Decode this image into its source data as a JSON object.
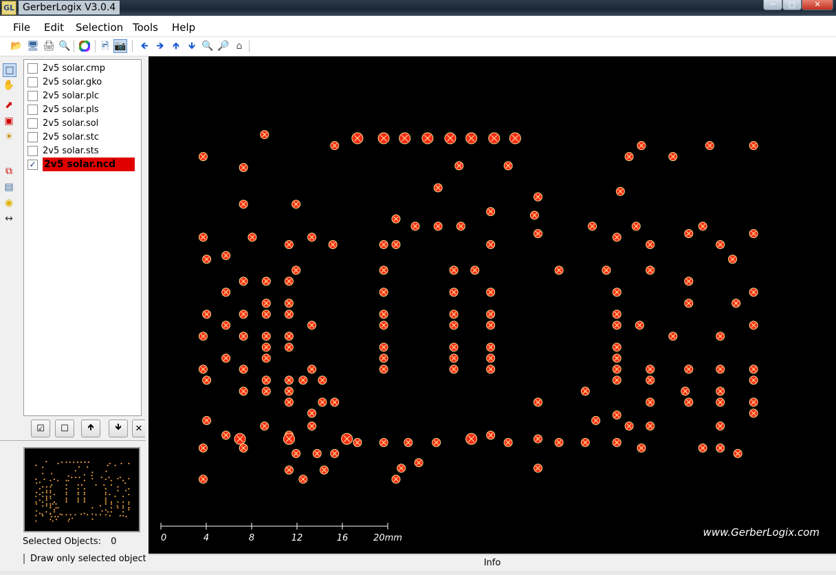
{
  "window": {
    "title": "GerberLogix   V3.0.4",
    "app_icon_text": "GL"
  },
  "menu": [
    "File",
    "Edit",
    "Selection",
    "Tools",
    "Help"
  ],
  "files": [
    {
      "name": "2v5 solar.cmp",
      "checked": false
    },
    {
      "name": "2v5 solar.gko",
      "checked": false
    },
    {
      "name": "2v5 solar.plc",
      "checked": false
    },
    {
      "name": "2v5 solar.pls",
      "checked": false
    },
    {
      "name": "2v5 solar.sol",
      "checked": false
    },
    {
      "name": "2v5 solar.stc",
      "checked": false
    },
    {
      "name": "2v5 solar.sts",
      "checked": false
    },
    {
      "name": "2v5 solar.ncd",
      "checked": true,
      "selected": true
    }
  ],
  "selected_objects_label": "Selected Objects:",
  "selected_objects_count": "0",
  "draw_only_label": "Draw only selected objects",
  "status_text": "Info",
  "watermark": "www.GerberLogix.com",
  "scale": {
    "ticks": [
      "0",
      "4",
      "8",
      "12",
      "16",
      "20mm"
    ]
  },
  "colors": {
    "hole_fill": "#f42a1a",
    "hole_ring": "#ffe088",
    "canvas_bg": "#000000",
    "selected_file_bg": "#e00000"
  },
  "board": {
    "holes_small": [
      [
        4.5,
        20.2
      ],
      [
        8.5,
        19.6
      ],
      [
        1.0,
        19.0
      ],
      [
        3.3,
        18.4
      ],
      [
        14.4,
        17.3
      ],
      [
        15.6,
        18.5
      ],
      [
        18.4,
        18.5
      ],
      [
        24.8,
        17.1
      ],
      [
        25.3,
        19.0
      ],
      [
        26.0,
        19.6
      ],
      [
        27.8,
        19.0
      ],
      [
        29.9,
        19.6
      ],
      [
        32.4,
        19.6
      ],
      [
        20.1,
        16.8
      ],
      [
        3.3,
        16.4
      ],
      [
        6.3,
        16.4
      ],
      [
        17.4,
        16.0
      ],
      [
        19.9,
        15.8
      ],
      [
        12.0,
        15.6
      ],
      [
        13.1,
        15.2
      ],
      [
        14.4,
        15.2
      ],
      [
        15.7,
        15.2
      ],
      [
        23.2,
        15.2
      ],
      [
        25.7,
        15.2
      ],
      [
        29.5,
        15.2
      ],
      [
        5.9,
        14.2
      ],
      [
        8.4,
        14.2
      ],
      [
        11.3,
        14.2
      ],
      [
        17.4,
        14.2
      ],
      [
        20.1,
        14.8
      ],
      [
        24.6,
        14.6
      ],
      [
        26.5,
        14.2
      ],
      [
        28.7,
        14.8
      ],
      [
        30.5,
        14.2
      ],
      [
        32.4,
        14.8
      ],
      [
        1.0,
        14.6
      ],
      [
        3.8,
        14.6
      ],
      [
        7.2,
        14.6
      ],
      [
        2.3,
        13.6
      ],
      [
        12.0,
        14.2
      ],
      [
        1.2,
        13.4
      ],
      [
        31.2,
        13.4
      ],
      [
        6.3,
        12.8
      ],
      [
        11.3,
        12.8
      ],
      [
        15.3,
        12.8
      ],
      [
        16.5,
        12.8
      ],
      [
        21.3,
        12.8
      ],
      [
        24.0,
        12.8
      ],
      [
        26.5,
        12.8
      ],
      [
        3.3,
        12.2
      ],
      [
        4.6,
        12.2
      ],
      [
        5.9,
        12.2
      ],
      [
        28.7,
        12.2
      ],
      [
        2.3,
        11.6
      ],
      [
        11.3,
        11.6
      ],
      [
        15.3,
        11.6
      ],
      [
        17.4,
        11.6
      ],
      [
        24.6,
        11.6
      ],
      [
        32.4,
        11.6
      ],
      [
        4.6,
        11.0
      ],
      [
        5.9,
        11.0
      ],
      [
        28.7,
        11.0
      ],
      [
        31.4,
        11.0
      ],
      [
        1.2,
        10.4
      ],
      [
        3.3,
        10.4
      ],
      [
        4.6,
        10.4
      ],
      [
        5.9,
        10.4
      ],
      [
        11.3,
        10.4
      ],
      [
        15.3,
        10.4
      ],
      [
        17.4,
        10.4
      ],
      [
        24.6,
        10.4
      ],
      [
        7.2,
        9.8
      ],
      [
        11.3,
        9.8
      ],
      [
        15.3,
        9.8
      ],
      [
        17.4,
        9.8
      ],
      [
        24.6,
        9.8
      ],
      [
        25.9,
        9.8
      ],
      [
        32.4,
        9.8
      ],
      [
        2.3,
        9.8
      ],
      [
        1.0,
        9.2
      ],
      [
        3.3,
        9.2
      ],
      [
        4.6,
        9.2
      ],
      [
        5.9,
        9.2
      ],
      [
        27.8,
        9.2
      ],
      [
        30.5,
        9.2
      ],
      [
        4.6,
        8.6
      ],
      [
        5.9,
        8.6
      ],
      [
        11.3,
        8.6
      ],
      [
        15.3,
        8.6
      ],
      [
        17.4,
        8.6
      ],
      [
        24.6,
        8.6
      ],
      [
        2.3,
        8.0
      ],
      [
        4.6,
        8.0
      ],
      [
        11.3,
        8.0
      ],
      [
        15.3,
        8.0
      ],
      [
        17.4,
        8.0
      ],
      [
        24.6,
        8.0
      ],
      [
        3.3,
        7.4
      ],
      [
        7.2,
        7.4
      ],
      [
        11.3,
        7.4
      ],
      [
        15.3,
        7.4
      ],
      [
        17.4,
        7.4
      ],
      [
        24.6,
        7.4
      ],
      [
        26.5,
        7.4
      ],
      [
        28.7,
        7.4
      ],
      [
        30.5,
        7.4
      ],
      [
        32.4,
        7.4
      ],
      [
        1.0,
        7.4
      ],
      [
        1.2,
        6.8
      ],
      [
        4.6,
        6.8
      ],
      [
        5.9,
        6.8
      ],
      [
        6.7,
        6.8
      ],
      [
        7.8,
        6.8
      ],
      [
        26.5,
        6.8
      ],
      [
        32.4,
        6.8
      ],
      [
        22.8,
        6.2
      ],
      [
        30.5,
        6.2
      ],
      [
        3.3,
        6.2
      ],
      [
        4.6,
        6.2
      ],
      [
        5.9,
        6.2
      ],
      [
        5.9,
        5.6
      ],
      [
        7.8,
        5.6
      ],
      [
        8.5,
        5.6
      ],
      [
        20.1,
        5.6
      ],
      [
        26.5,
        5.6
      ],
      [
        28.7,
        5.6
      ],
      [
        30.5,
        5.6
      ],
      [
        32.4,
        5.6
      ],
      [
        7.2,
        5.0
      ],
      [
        32.4,
        5.0
      ],
      [
        4.5,
        4.3
      ],
      [
        1.2,
        4.6
      ],
      [
        7.2,
        4.3
      ],
      [
        26.5,
        4.3
      ],
      [
        30.5,
        4.3
      ],
      [
        2.3,
        3.8
      ],
      [
        5.9,
        3.8
      ],
      [
        9.8,
        3.4
      ],
      [
        11.3,
        3.4
      ],
      [
        12.7,
        3.4
      ],
      [
        14.3,
        3.4
      ],
      [
        1.0,
        3.1
      ],
      [
        3.3,
        3.1
      ],
      [
        30.5,
        3.1
      ],
      [
        25.3,
        4.3
      ],
      [
        24.6,
        3.4
      ],
      [
        21.3,
        3.4
      ],
      [
        22.8,
        3.4
      ],
      [
        29.5,
        3.1
      ],
      [
        6.3,
        2.8
      ],
      [
        7.5,
        2.8
      ],
      [
        8.5,
        2.8
      ],
      [
        31.5,
        2.8
      ],
      [
        12.3,
        2.0
      ],
      [
        13.3,
        2.3
      ],
      [
        20.1,
        2.0
      ],
      [
        20.1,
        3.6
      ],
      [
        1.0,
        1.4
      ],
      [
        12.0,
        1.4
      ],
      [
        7.9,
        1.9
      ],
      [
        5.9,
        1.9
      ],
      [
        6.7,
        1.4
      ],
      [
        17.4,
        3.8
      ],
      [
        18.4,
        3.4
      ],
      [
        26.0,
        3.1
      ],
      [
        24.6,
        4.9
      ],
      [
        23.4,
        4.6
      ],
      [
        28.5,
        6.2
      ],
      [
        24.6,
        6.8
      ]
    ],
    "holes_large": [
      [
        9.8,
        20.0
      ],
      [
        11.3,
        20.0
      ],
      [
        12.5,
        20.0
      ],
      [
        13.8,
        20.0
      ],
      [
        15.1,
        20.0
      ],
      [
        16.3,
        20.0
      ],
      [
        17.6,
        20.0
      ],
      [
        18.8,
        20.0
      ],
      [
        3.1,
        3.6
      ],
      [
        5.9,
        3.6
      ],
      [
        9.2,
        3.6
      ],
      [
        16.3,
        3.6
      ]
    ]
  }
}
